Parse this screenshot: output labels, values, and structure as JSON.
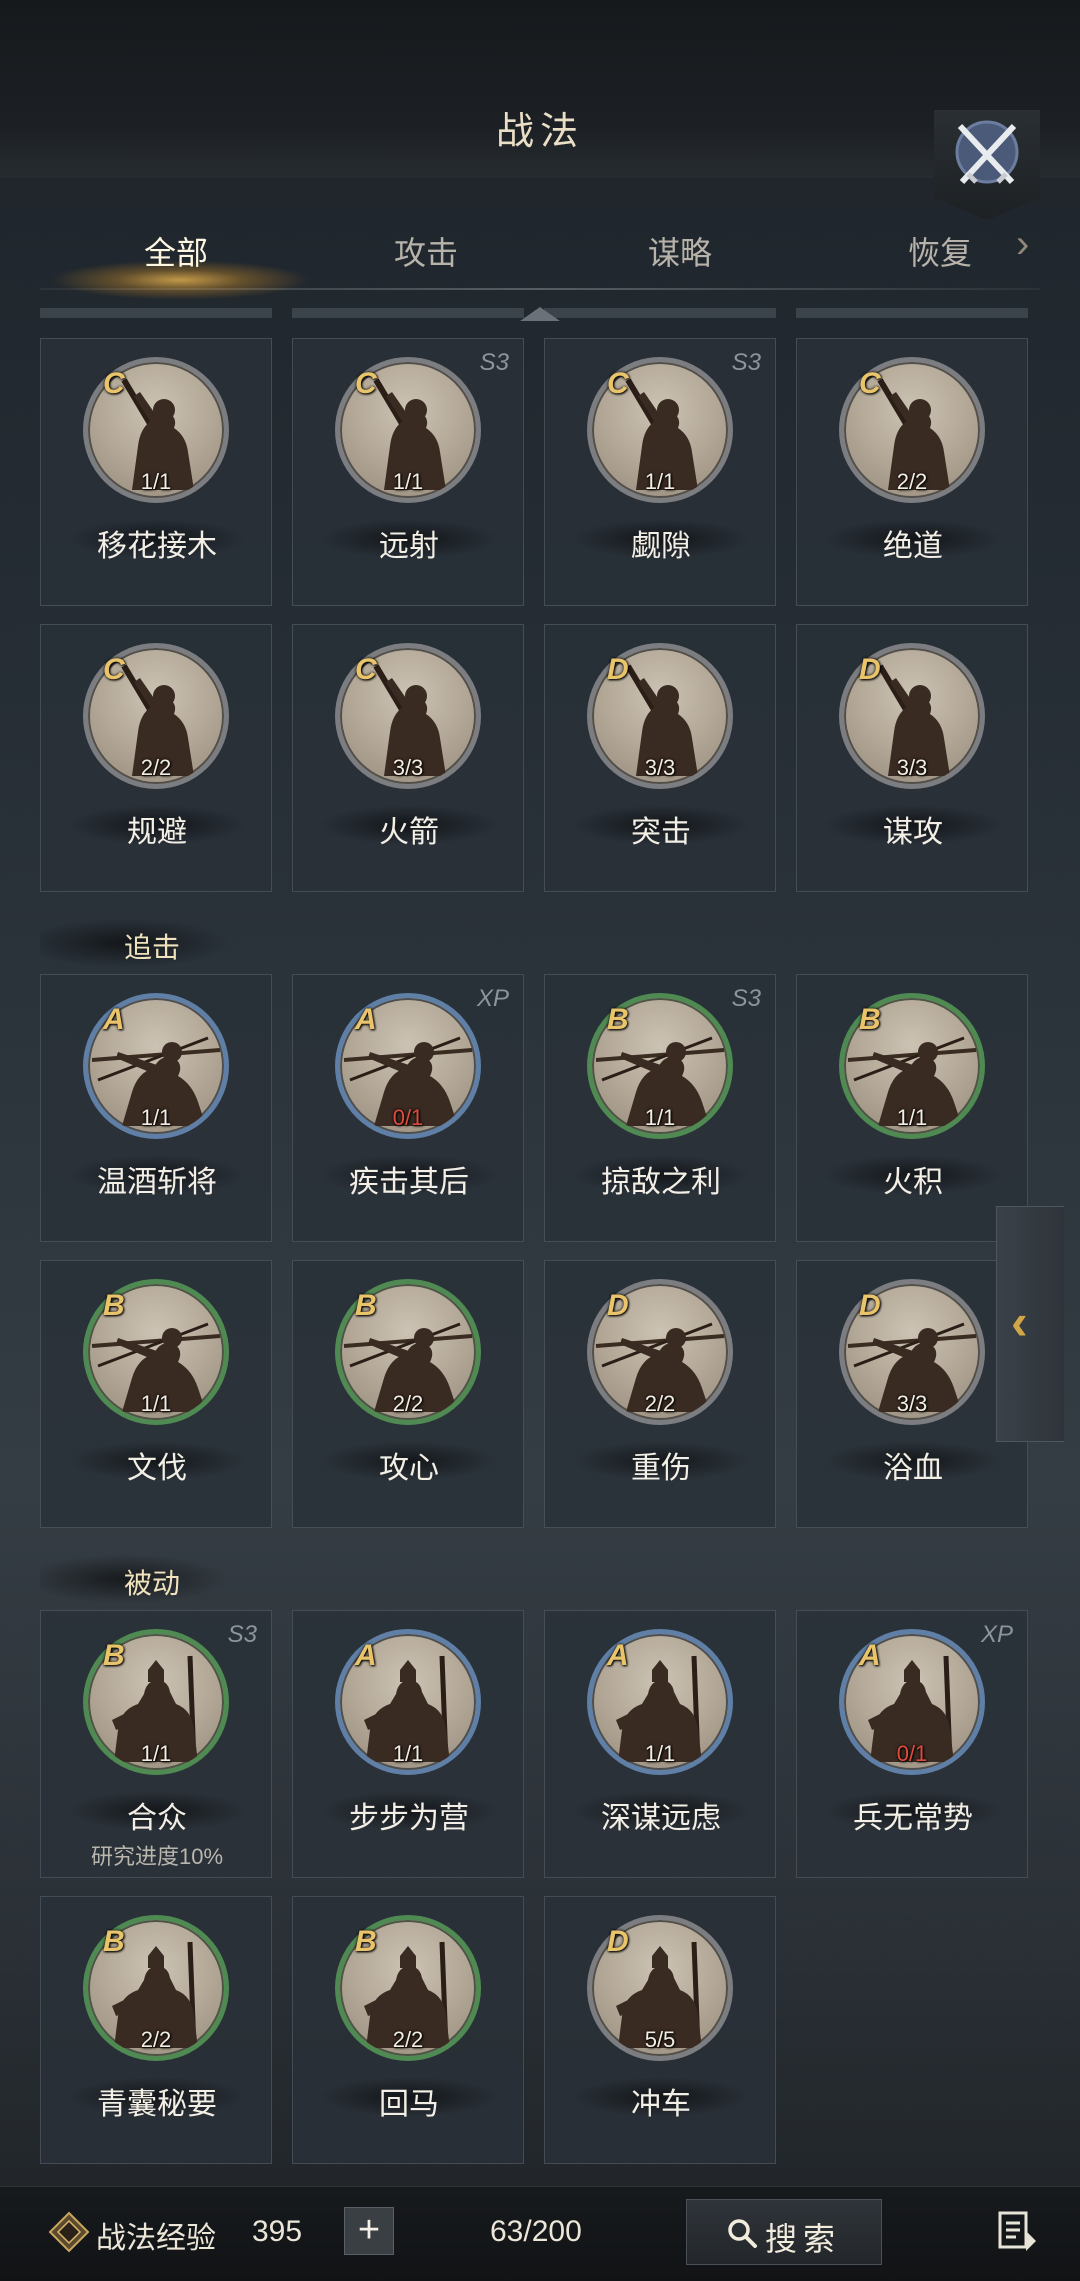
{
  "header": {
    "title": "战法"
  },
  "tabs": [
    {
      "label": "全部",
      "active": true
    },
    {
      "label": "攻击",
      "active": false
    },
    {
      "label": "谋略",
      "active": false
    },
    {
      "label": "恢复",
      "active": false
    }
  ],
  "sections": [
    {
      "title": "",
      "cards": [
        {
          "grade": "C",
          "season": "",
          "count": "1/1",
          "name": "移花接木",
          "sub": "",
          "ring": "gray",
          "icon": "spear-soldier-icon"
        },
        {
          "grade": "C",
          "season": "S3",
          "count": "1/1",
          "name": "远射",
          "sub": "",
          "ring": "gray",
          "icon": "spear-soldier-icon"
        },
        {
          "grade": "C",
          "season": "S3",
          "count": "1/1",
          "name": "觑隙",
          "sub": "",
          "ring": "gray",
          "icon": "spear-soldier-icon"
        },
        {
          "grade": "C",
          "season": "",
          "count": "2/2",
          "name": "绝道",
          "sub": "",
          "ring": "gray",
          "icon": "spear-soldier-icon"
        },
        {
          "grade": "C",
          "season": "",
          "count": "2/2",
          "name": "规避",
          "sub": "",
          "ring": "gray",
          "icon": "spear-soldier-icon"
        },
        {
          "grade": "C",
          "season": "",
          "count": "3/3",
          "name": "火箭",
          "sub": "",
          "ring": "gray",
          "icon": "spear-soldier-icon"
        },
        {
          "grade": "D",
          "season": "",
          "count": "3/3",
          "name": "突击",
          "sub": "",
          "ring": "gray",
          "icon": "spear-soldier-icon"
        },
        {
          "grade": "D",
          "season": "",
          "count": "3/3",
          "name": "谋攻",
          "sub": "",
          "ring": "gray",
          "icon": "spear-soldier-icon"
        }
      ]
    },
    {
      "title": "追击",
      "cards": [
        {
          "grade": "A",
          "season": "",
          "count": "1/1",
          "name": "温酒斩将",
          "sub": "",
          "ring": "blue",
          "icon": "slashing-warrior-icon"
        },
        {
          "grade": "A",
          "season": "XP",
          "count": "0/1",
          "name": "疾击其后",
          "sub": "",
          "ring": "blue",
          "icon": "slashing-warrior-icon"
        },
        {
          "grade": "B",
          "season": "S3",
          "count": "1/1",
          "name": "掠敌之利",
          "sub": "",
          "ring": "green",
          "icon": "slashing-warrior-icon"
        },
        {
          "grade": "B",
          "season": "",
          "count": "1/1",
          "name": "火积",
          "sub": "",
          "ring": "green",
          "icon": "slashing-warrior-icon"
        },
        {
          "grade": "B",
          "season": "",
          "count": "1/1",
          "name": "文伐",
          "sub": "",
          "ring": "green",
          "icon": "slashing-warrior-icon"
        },
        {
          "grade": "B",
          "season": "",
          "count": "2/2",
          "name": "攻心",
          "sub": "",
          "ring": "green",
          "icon": "slashing-warrior-icon"
        },
        {
          "grade": "D",
          "season": "",
          "count": "2/2",
          "name": "重伤",
          "sub": "",
          "ring": "gray",
          "icon": "slashing-warrior-icon"
        },
        {
          "grade": "D",
          "season": "",
          "count": "3/3",
          "name": "浴血",
          "sub": "",
          "ring": "gray",
          "icon": "slashing-warrior-icon"
        }
      ]
    },
    {
      "title": "被动",
      "cards": [
        {
          "grade": "B",
          "season": "S3",
          "count": "1/1",
          "name": "合众",
          "sub": "研究进度10%",
          "ring": "green",
          "icon": "armored-general-icon"
        },
        {
          "grade": "A",
          "season": "",
          "count": "1/1",
          "name": "步步为营",
          "sub": "",
          "ring": "blue",
          "icon": "armored-general-icon"
        },
        {
          "grade": "A",
          "season": "",
          "count": "1/1",
          "name": "深谋远虑",
          "sub": "",
          "ring": "blue",
          "icon": "armored-general-icon"
        },
        {
          "grade": "A",
          "season": "XP",
          "count": "0/1",
          "name": "兵无常势",
          "sub": "",
          "ring": "blue",
          "icon": "armored-general-icon"
        },
        {
          "grade": "B",
          "season": "",
          "count": "2/2",
          "name": "青囊秘要",
          "sub": "",
          "ring": "green",
          "icon": "armored-general-icon"
        },
        {
          "grade": "B",
          "season": "",
          "count": "2/2",
          "name": "回马",
          "sub": "",
          "ring": "green",
          "icon": "armored-general-icon"
        },
        {
          "grade": "D",
          "season": "",
          "count": "5/5",
          "name": "冲车",
          "sub": "",
          "ring": "gray",
          "icon": "armored-general-icon"
        }
      ]
    }
  ],
  "footer": {
    "xp_label": "战法经验",
    "xp_value": "395",
    "plus_label": "+",
    "capacity": "63/200",
    "search_label": "搜索"
  },
  "colors": {
    "accent_gold": "#e9c46a",
    "ring_green": "#4f8a52",
    "ring_blue": "#5f7fa6",
    "ring_gray": "#7b7d80",
    "count_red": "#e04b3e"
  }
}
